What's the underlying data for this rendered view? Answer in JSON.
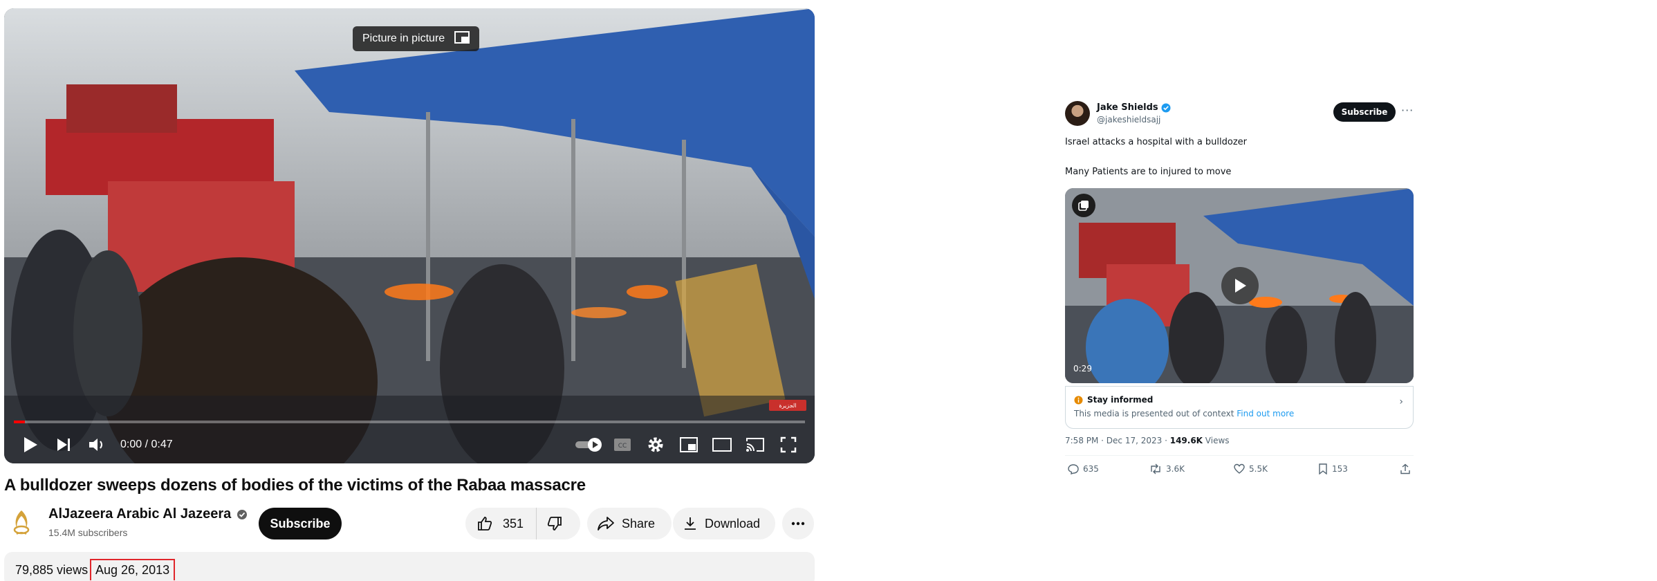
{
  "youtube": {
    "pip_tooltip": "Picture in picture",
    "time_display": "0:00 / 0:47",
    "progress_fraction": 0.0,
    "watermark": "الجزيرة",
    "title": "A bulldozer sweeps dozens of bodies of the victims of the Rabaa massacre",
    "channel_name": "AlJazeera Arabic Al Jazeera",
    "subscribers": "15.4M subscribers",
    "subscribe_label": "Subscribe",
    "like_count": "351",
    "share_label": "Share",
    "download_label": "Download",
    "views": "79,885 views",
    "upload_date": "Aug 26, 2013",
    "accent_color": "#ff0000",
    "highlight_color": "#e0262b"
  },
  "tweet": {
    "display_name": "Jake Shields",
    "handle": "@jakeshieldsajj",
    "subscribe_label": "Subscribe",
    "text_line1": "Israel attacks a hospital with a bulldozer",
    "text_line2": "Many Patients are to injured to move",
    "video_duration": "0:29",
    "context_title": "Stay informed",
    "context_body": "This media is presented out of context",
    "context_link": "Find out more",
    "timestamp": "7:58 PM · Dec 17, 2023 · ",
    "view_count": "149.6K",
    "views_label": " Views",
    "replies": "635",
    "reposts": "3.6K",
    "likes": "5.5K",
    "bookmarks": "153",
    "link_color": "#1d9bf0"
  }
}
